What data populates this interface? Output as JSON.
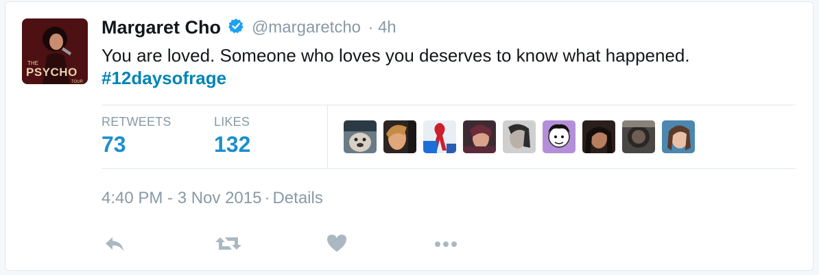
{
  "tweet": {
    "author_name": "Margaret Cho",
    "handle": "@margaretcho",
    "age": "4h",
    "separator": "·",
    "text": "You are loved. Someone who loves you deserves to know what happened.",
    "hashtag": "#12daysofrage",
    "timestamp": "4:40 PM - 3 Nov 2015",
    "details_link": "Details"
  },
  "avatar": {
    "caption_line1": "THE",
    "caption_line2": "PSYCHO",
    "caption_line3": "TOUR"
  },
  "stats": {
    "retweets_label": "RETWEETS",
    "retweets_count": "73",
    "likes_label": "LIKES",
    "likes_count": "132"
  },
  "likers_count": 9,
  "actions": [
    "reply-icon",
    "retweet-icon",
    "like-icon",
    "more-icon"
  ],
  "colors": {
    "link": "#1b8fcc",
    "muted": "#8899a6",
    "verified": "#1da1f2",
    "icon": "#aab8c2"
  }
}
